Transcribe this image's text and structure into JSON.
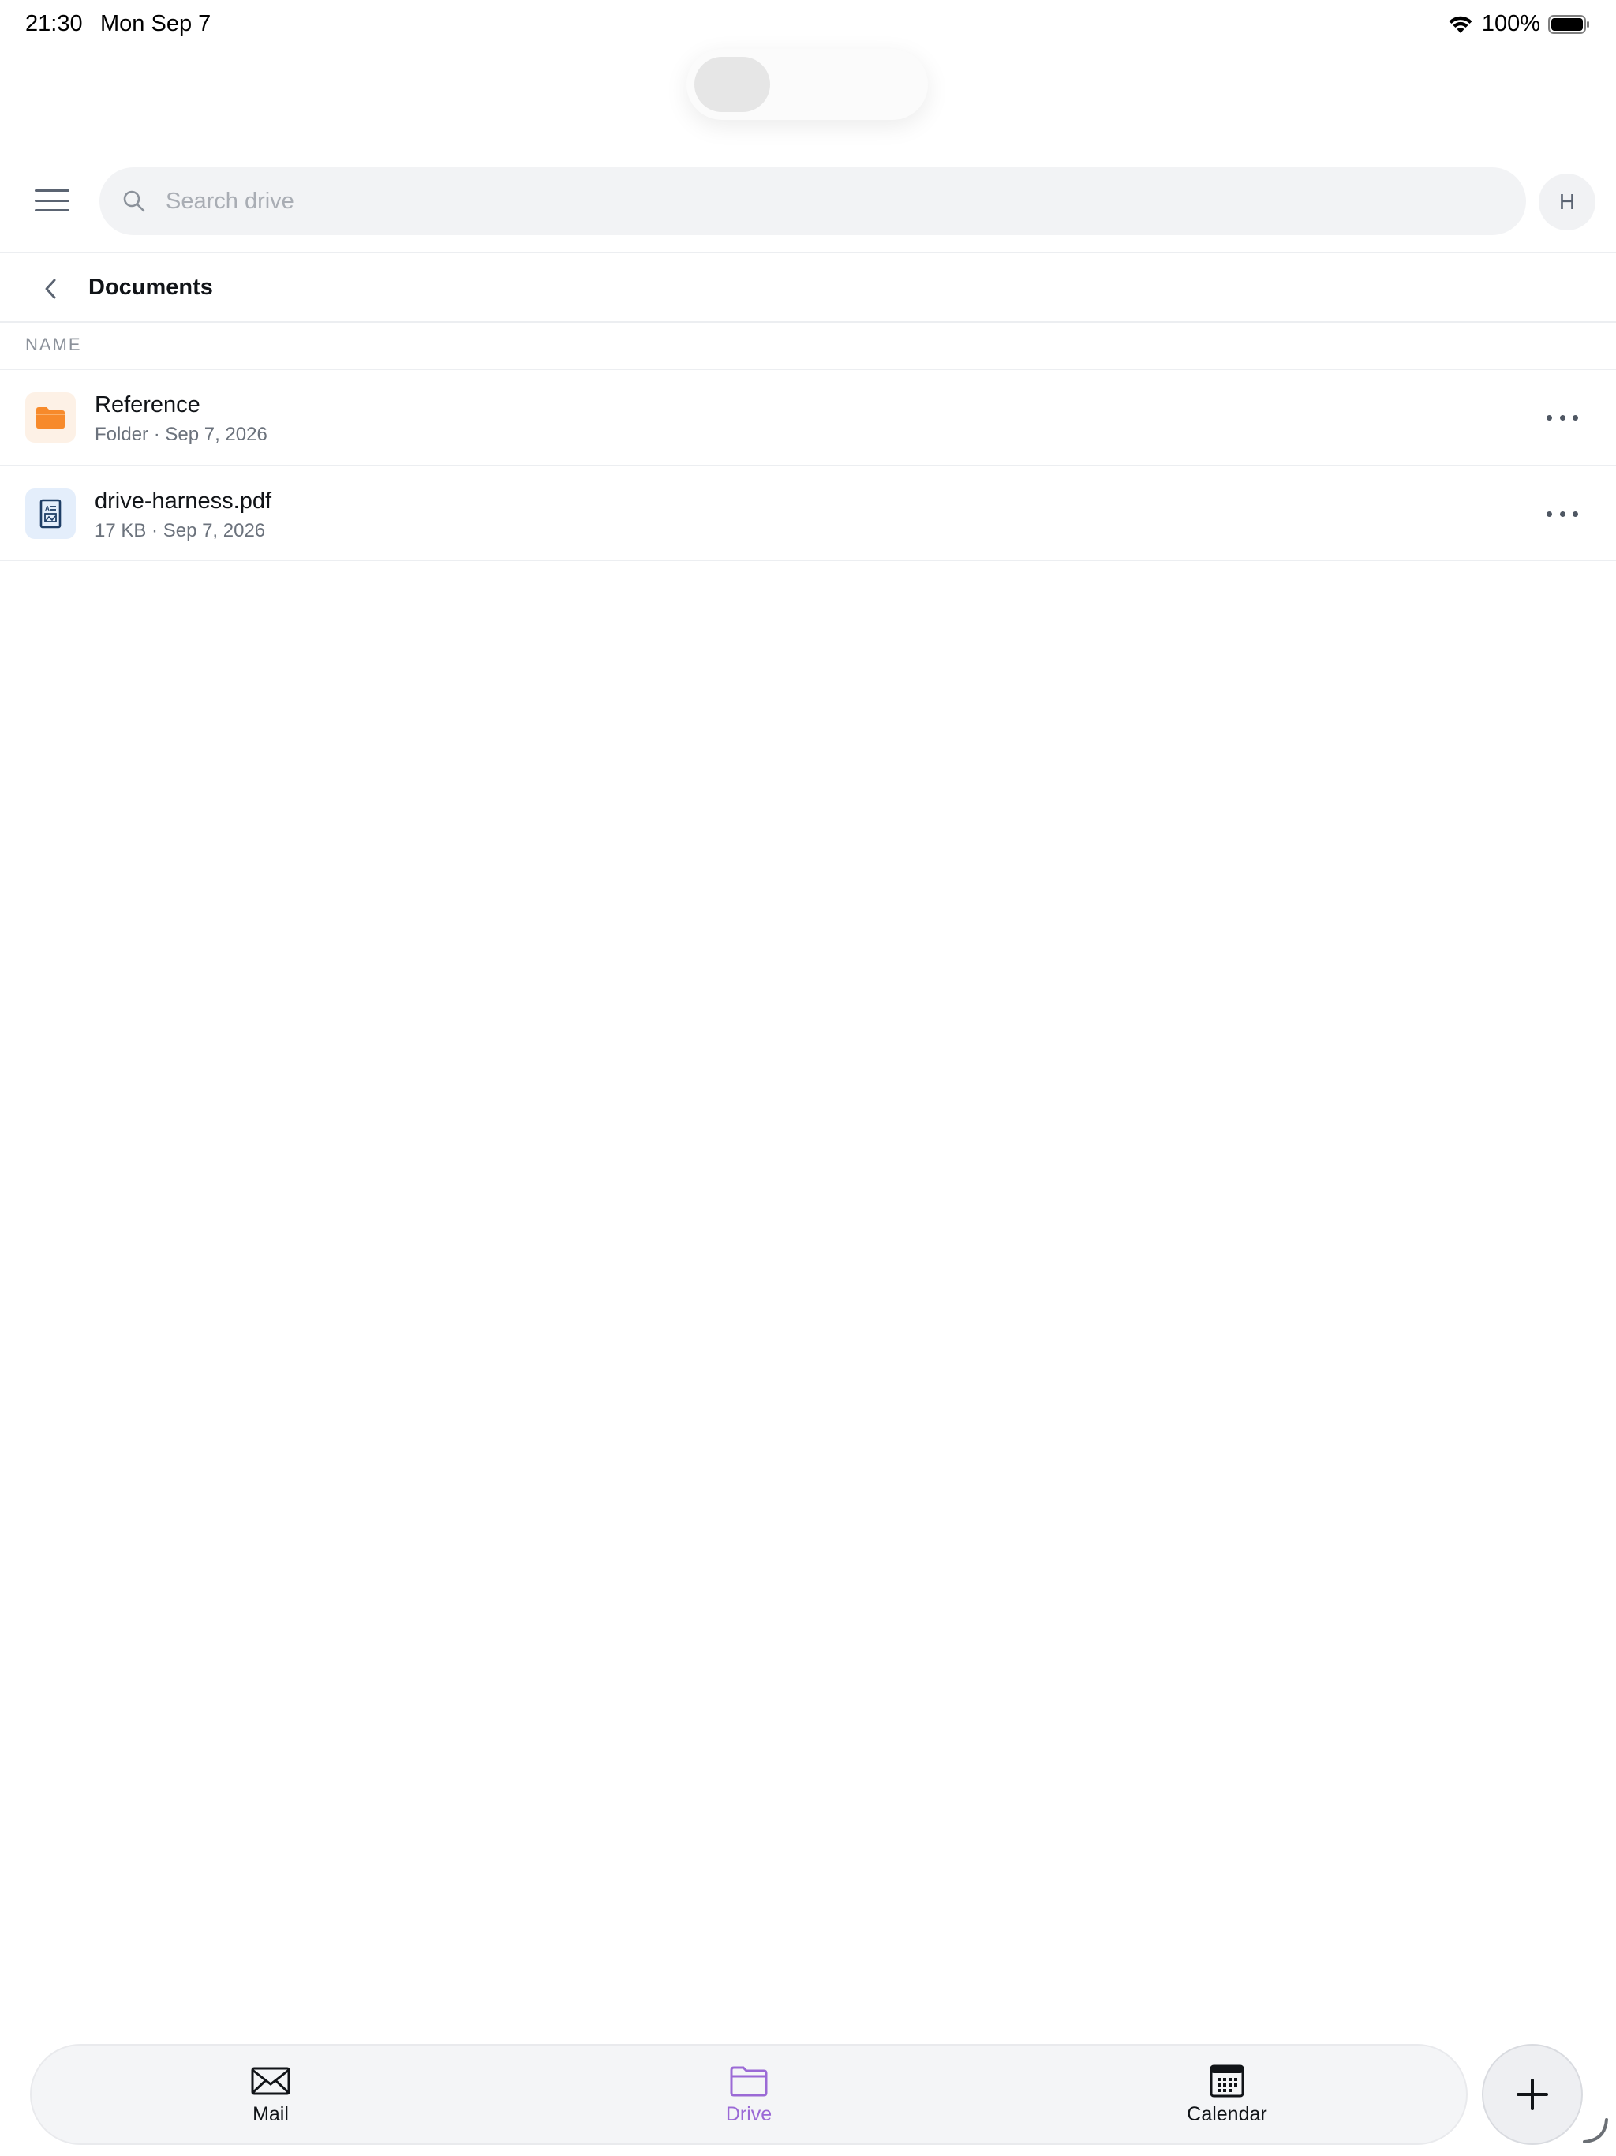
{
  "status_bar": {
    "time": "21:30",
    "date": "Mon Sep 7",
    "battery": "100%"
  },
  "header": {
    "search_placeholder": "Search drive",
    "avatar_initial": "H"
  },
  "breadcrumb": {
    "title": "Documents"
  },
  "list": {
    "column_name": "NAME",
    "items": [
      {
        "name": "Reference",
        "meta": "Folder · Sep 7, 2026",
        "icon": "folder-icon"
      },
      {
        "name": "drive-harness.pdf",
        "meta": "17 KB · Sep 7, 2026",
        "icon": "pdf-file-icon"
      }
    ]
  },
  "tabs": [
    {
      "label": "Mail",
      "icon": "mail-icon",
      "active": false
    },
    {
      "label": "Drive",
      "icon": "folder-icon",
      "active": true
    },
    {
      "label": "Calendar",
      "icon": "calendar-icon",
      "active": false
    }
  ],
  "colors": {
    "accent": "#9b6ad6",
    "folder": "#f78a2b",
    "folder_bg": "#fdf1e6",
    "file_bg": "#e4eefb",
    "file_icon": "#1f3e66"
  }
}
